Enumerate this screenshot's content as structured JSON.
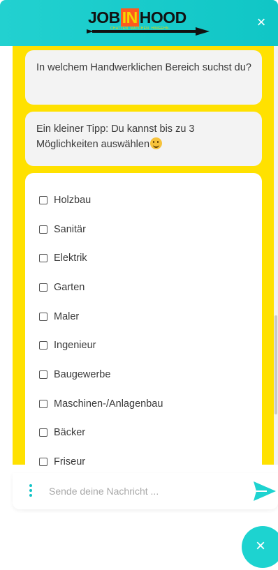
{
  "brand": {
    "logo_job": "JOB",
    "logo_in": "IN",
    "logo_hood": "HOOD",
    "logo_tagline": "CHATTEN. MATCHEN. HINGEHN.",
    "accent": "#1dd3d0",
    "background": "#ffe100"
  },
  "header": {
    "close_icon": "×"
  },
  "messages": [
    {
      "text": "In welchem Handwerklichen Bereich suchst du?"
    },
    {
      "text": "Ein kleiner Tipp: Du kannst bis zu 3 Möglichkeiten auswählen"
    }
  ],
  "options": [
    "Holzbau",
    "Sanitär",
    "Elektrik",
    "Garten",
    "Maler",
    "Ingenieur",
    "Baugewerbe",
    "Maschinen-/Anlagenbau",
    "Bäcker",
    "Friseur"
  ],
  "composer": {
    "placeholder": "Sende deine Nachricht ...",
    "send_icon": "send-icon",
    "menu_icon": "more-vertical-icon"
  },
  "launcher": {
    "close_icon": "×"
  }
}
